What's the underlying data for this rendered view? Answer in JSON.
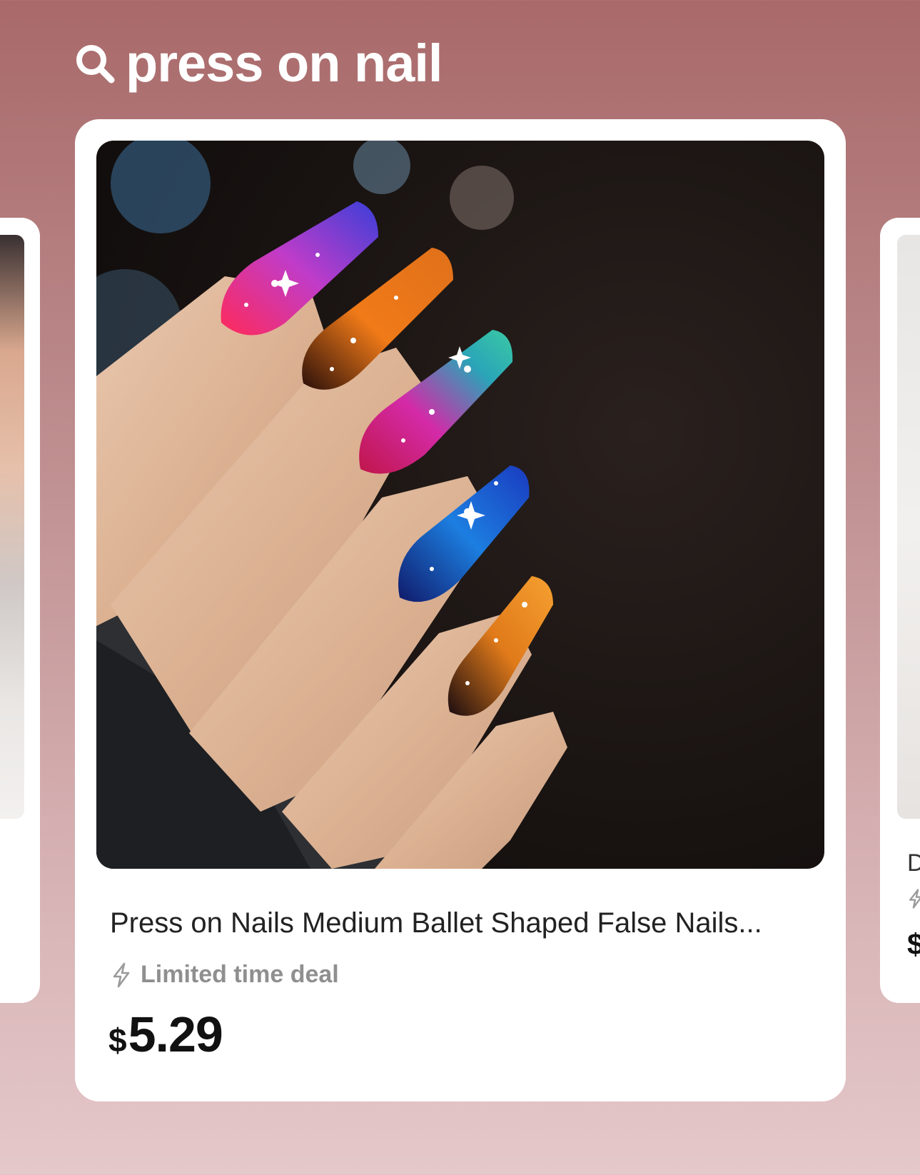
{
  "search": {
    "query": "press on nail",
    "icon": "search-icon"
  },
  "product": {
    "image_alt": "Hand with galaxy-themed press on nails",
    "title": "Press on Nails Medium Ballet Shaped False Nails...",
    "deal_label": "Limited time deal",
    "deal_icon": "lightning-bolt-icon",
    "price_currency": "$",
    "price_amount": "5.29"
  },
  "peek_left": {
    "dots": ".."
  },
  "peek_right": {
    "title_initial": "D",
    "price_currency": "$"
  },
  "colors": {
    "background_top": "#a9696a",
    "background_bottom": "#e5c8ca",
    "card": "#ffffff",
    "price_text": "#111111",
    "deal_text": "#8f8f8f"
  }
}
